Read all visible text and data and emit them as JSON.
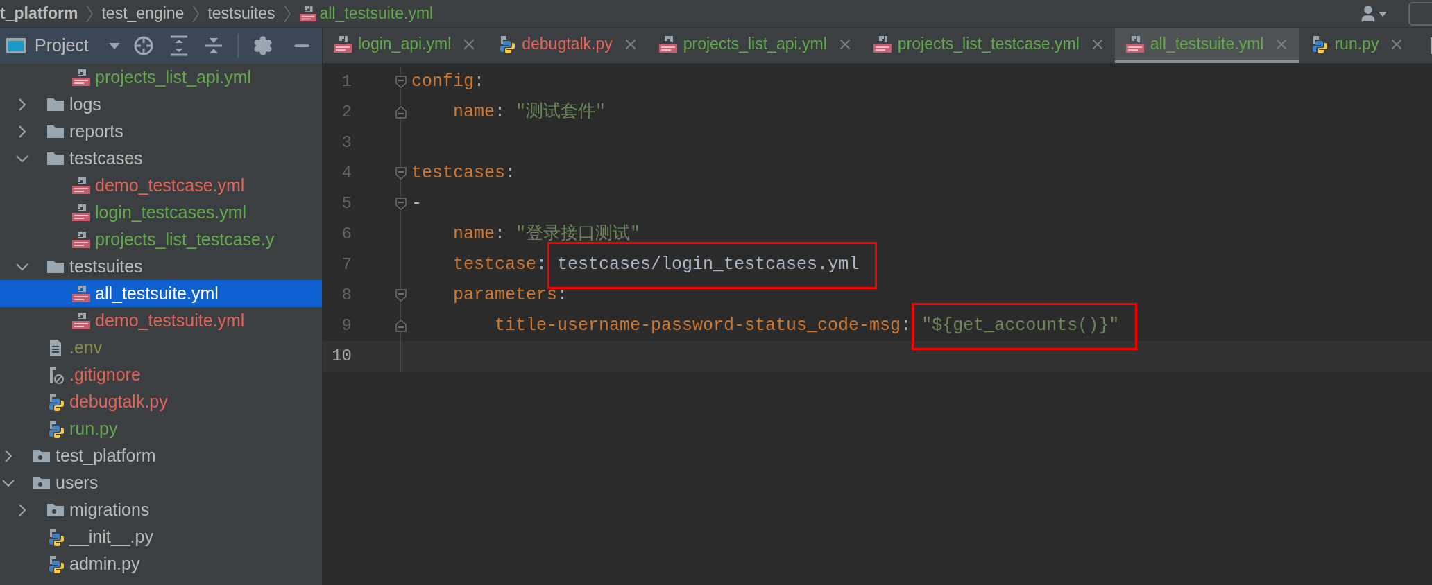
{
  "breadcrumbs": [
    {
      "label": "t_platform",
      "kind": "root",
      "color": "#bbbbbb"
    },
    {
      "label": "test_engine",
      "kind": "folder",
      "color": "#bbbbbb"
    },
    {
      "label": "testsuites",
      "kind": "folder",
      "color": "#bbbbbb"
    },
    {
      "label": "all_testsuite.yml",
      "kind": "yml",
      "color": "#62a84c"
    }
  ],
  "project_panel": {
    "title": "Project",
    "tree": [
      {
        "children": [
          {
            "children": [
              {
                "label": "projects_list_api.yml",
                "kind": "yml",
                "color": "#62a84c",
                "selected": false
              }
            ]
          },
          {
            "label": "logs",
            "kind": "folder",
            "color": "#bbbbbb",
            "expanded": false,
            "selected": false
          },
          {
            "label": "reports",
            "kind": "folder",
            "color": "#bbbbbb",
            "expanded": false,
            "selected": false
          },
          {
            "label": "testcases",
            "kind": "folder",
            "color": "#bbbbbb",
            "expanded": true,
            "selected": false,
            "children": [
              {
                "label": "demo_testcase.yml",
                "kind": "yml",
                "color": "#e0645a",
                "selected": false
              },
              {
                "label": "login_testcases.yml",
                "kind": "yml",
                "color": "#62a84c",
                "selected": false
              },
              {
                "label": "projects_list_testcase.y",
                "kind": "yml",
                "color": "#62a84c",
                "selected": false
              }
            ]
          },
          {
            "label": "testsuites",
            "kind": "folder",
            "color": "#bbbbbb",
            "expanded": true,
            "selected": false,
            "children": [
              {
                "label": "all_testsuite.yml",
                "kind": "yml",
                "selected": true
              },
              {
                "label": "demo_testsuite.yml",
                "kind": "yml",
                "color": "#e0645a",
                "selected": false
              }
            ]
          },
          {
            "label": ".env",
            "kind": "text",
            "color": "#878d47",
            "selected": false
          },
          {
            "label": ".gitignore",
            "kind": "ignore",
            "color": "#e0645a",
            "selected": false
          },
          {
            "label": "debugtalk.py",
            "kind": "py",
            "color": "#e0645a",
            "selected": false
          },
          {
            "label": "run.py",
            "kind": "py",
            "color": "#62a84c",
            "selected": false
          }
        ]
      },
      {
        "label": "test_platform",
        "kind": "module",
        "color": "#bbbbbb",
        "expanded": false,
        "selected": false
      },
      {
        "label": "users",
        "kind": "module",
        "color": "#bbbbbb",
        "expanded": true,
        "selected": false,
        "children": [
          {
            "label": "migrations",
            "kind": "module",
            "color": "#bbbbbb",
            "expanded": false,
            "selected": false
          },
          {
            "label": "__init__.py",
            "kind": "py",
            "color": "#bbbbbb",
            "selected": false
          },
          {
            "label": "admin.py",
            "kind": "py",
            "color": "#bbbbbb",
            "selected": false
          }
        ]
      }
    ]
  },
  "tabs": [
    {
      "label": "login_api.yml",
      "kind": "yml",
      "color": "#62a84c",
      "selected": false
    },
    {
      "label": "debugtalk.py",
      "kind": "py",
      "color": "#e0645a",
      "selected": false
    },
    {
      "label": "projects_list_api.yml",
      "kind": "yml",
      "color": "#62a84c",
      "selected": false
    },
    {
      "label": "projects_list_testcase.yml",
      "kind": "yml",
      "color": "#62a84c",
      "selected": false
    },
    {
      "label": "all_testsuite.yml",
      "kind": "yml",
      "color": "#62a84c",
      "selected": true
    },
    {
      "label": "run.py",
      "kind": "py",
      "color": "#62a84c",
      "selected": false
    }
  ],
  "editor": {
    "lines": [
      {
        "number": "1",
        "kind": "opener",
        "current": false,
        "tokens": [
          {
            "kind": "key",
            "text": "config"
          },
          {
            "kind": "plain",
            "text": ":"
          }
        ]
      },
      {
        "number": "2",
        "kind": "closer",
        "current": false,
        "tokens": [
          {
            "kind": "key",
            "text": "    name"
          },
          {
            "kind": "plain",
            "text": ": "
          },
          {
            "kind": "string",
            "text": "\"测试套件\""
          }
        ]
      },
      {
        "number": "3",
        "kind": "plain",
        "current": false
      },
      {
        "number": "4",
        "kind": "opener",
        "current": false,
        "tokens": [
          {
            "kind": "key",
            "text": "testcases"
          },
          {
            "kind": "plain",
            "text": ":"
          }
        ]
      },
      {
        "number": "5",
        "kind": "opener",
        "current": false,
        "tokens": [
          {
            "kind": "plain",
            "text": "-"
          }
        ]
      },
      {
        "number": "6",
        "kind": "plain",
        "current": false,
        "tokens": [
          {
            "kind": "key",
            "text": "    name"
          },
          {
            "kind": "plain",
            "text": ": "
          },
          {
            "kind": "string",
            "text": "\"登录接口测试\""
          }
        ]
      },
      {
        "number": "7",
        "kind": "plain",
        "current": false,
        "tokens": [
          {
            "kind": "key",
            "text": "    testcase"
          },
          {
            "kind": "plain",
            "text": ": "
          },
          {
            "kind": "plain",
            "text": "testcases/login_testcases.yml",
            "boxed": true
          }
        ]
      },
      {
        "number": "8",
        "kind": "opener",
        "current": false,
        "tokens": [
          {
            "kind": "key",
            "text": "    parameters"
          },
          {
            "kind": "plain",
            "text": ":"
          }
        ]
      },
      {
        "number": "9",
        "kind": "closer",
        "current": false,
        "tokens": [
          {
            "kind": "key",
            "text": "        title-username-password-status_code-msg"
          },
          {
            "kind": "plain",
            "text": ": "
          },
          {
            "kind": "string",
            "text": "\"${get_accounts()}\"",
            "boxed": true
          }
        ]
      },
      {
        "number": "10",
        "kind": "plain",
        "current": true
      }
    ]
  }
}
